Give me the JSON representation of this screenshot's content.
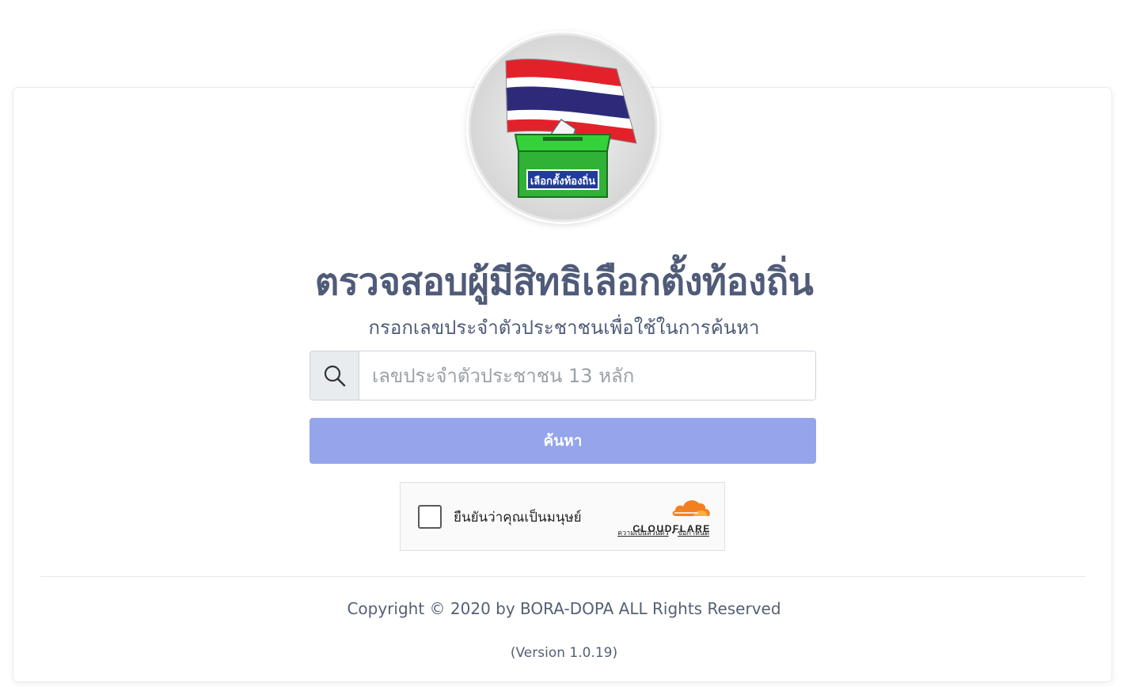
{
  "logo": {
    "box_label": "เลือกตั้งท้องถิ่น",
    "icon": "ballot-box-thai-flag-logo"
  },
  "header": {
    "title": "ตรวจสอบผู้มีสิทธิเลือกตั้งท้องถิ่น",
    "subtitle": "กรอกเลขประจำตัวประชาชนเพื่อใช้ในการค้นหา"
  },
  "search": {
    "icon": "search-icon",
    "placeholder": "เลขประจำตัวประชาชน 13 หลัก",
    "value": "",
    "button_label": "ค้นหา"
  },
  "captcha": {
    "label": "ยืนยันว่าคุณเป็นมนุษย์",
    "brand": "CLOUDFLARE",
    "privacy_link": "ความเป็นส่วนตัว",
    "separator": "•",
    "terms_link": "ข้อกำหนด"
  },
  "footer": {
    "copyright": "Copyright © 2020 by BORA-DOPA ALL Rights Reserved",
    "version": "(Version 1.0.19)"
  },
  "colors": {
    "title": "#4f5b78",
    "button": "#95a5eb",
    "cloudflare_orange": "#f38020"
  }
}
